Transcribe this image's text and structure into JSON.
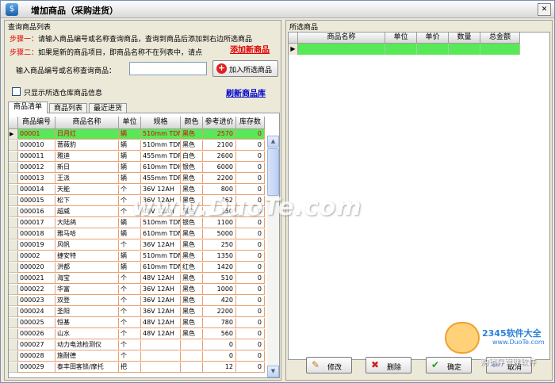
{
  "window": {
    "title": "增加商品（采购进货）",
    "close_glyph": "✕",
    "app_icon_glyph": "$"
  },
  "left_panel": {
    "title": "查询商品列表",
    "step1_label": "步骤一：",
    "step1_text": "请输入商品编号或名称查询商品，查询到商品后添加到右边所选商品",
    "step2_label": "步骤二：",
    "step2_text": "如果是新的商品项目，即商品名称不在列表中，请点",
    "add_new_link": "添加新商品",
    "search_label": "输入商品编号或名称查询商品：",
    "search_value": "",
    "add_button_label": "加入所选商品",
    "checkbox_label": "只显示所选仓库商品信息",
    "checkbox_checked": false,
    "refresh_link": "刷新商品库",
    "tabs": [
      {
        "label": "商品清单",
        "active": true
      },
      {
        "label": "商品列表",
        "active": false
      },
      {
        "label": "最近进货",
        "active": false
      }
    ]
  },
  "product_grid": {
    "columns": [
      "商品编号",
      "商品名称",
      "单位",
      "规格",
      "颜色",
      "参考进价",
      "库存数"
    ],
    "selected_index": 0,
    "rows": [
      [
        "00001",
        "日月红",
        "辆",
        "510mm TDN4",
        "黑色",
        "2570",
        "0"
      ],
      [
        "000010",
        "蔷薇豹",
        "辆",
        "510mm TDN4",
        "黑色",
        "2100",
        "0"
      ],
      [
        "000011",
        "雅迪",
        "辆",
        "455mm TDF1",
        "白色",
        "2600",
        "0"
      ],
      [
        "000012",
        "新日",
        "辆",
        "610mm TDH-",
        "银色",
        "6000",
        "0"
      ],
      [
        "000013",
        "王派",
        "辆",
        "455mm TDF1",
        "黑色",
        "2200",
        "0"
      ],
      [
        "000014",
        "天能",
        "个",
        "36V 12AH",
        "黑色",
        "800",
        "0"
      ],
      [
        "000015",
        "松下",
        "个",
        "36V 12AH",
        "黑色",
        "462",
        "0"
      ],
      [
        "000016",
        "超威",
        "个",
        "48V 12AH",
        "黑色",
        "350",
        "0"
      ],
      [
        "000017",
        "大陆鸽",
        "辆",
        "510mm TDNT",
        "银色",
        "1100",
        "0"
      ],
      [
        "000018",
        "雅马哈",
        "辆",
        "610mm TDMC",
        "黑色",
        "5000",
        "0"
      ],
      [
        "000019",
        "风帆",
        "个",
        "36V 12AH",
        "黑色",
        "250",
        "0"
      ],
      [
        "00002",
        "捷安特",
        "辆",
        "510mm TDN4",
        "黑色",
        "1350",
        "0"
      ],
      [
        "000020",
        "洪都",
        "辆",
        "610mm TDMC",
        "红色",
        "1420",
        "0"
      ],
      [
        "000021",
        "海宝",
        "个",
        "48V 12AH",
        "黑色",
        "510",
        "0"
      ],
      [
        "000022",
        "华富",
        "个",
        "36V 12AH",
        "黑色",
        "1000",
        "0"
      ],
      [
        "000023",
        "双登",
        "个",
        "36V 12AH",
        "黑色",
        "420",
        "0"
      ],
      [
        "000024",
        "圣阳",
        "个",
        "36V 12AH",
        "黑色",
        "2200",
        "0"
      ],
      [
        "000025",
        "恒基",
        "个",
        "48V 12AH",
        "黑色",
        "780",
        "0"
      ],
      [
        "000026",
        "山水",
        "个",
        "48V 12AH",
        "黑色",
        "560",
        "0"
      ],
      [
        "000027",
        "动力电池检测仪",
        "个",
        "",
        "",
        "0",
        "0"
      ],
      [
        "000028",
        "施耐德",
        "个",
        "",
        "",
        "0",
        "0"
      ],
      [
        "000029",
        "泰丰田客锁/摩托",
        "把",
        "",
        "",
        "12",
        "0"
      ]
    ]
  },
  "scrollbar": {
    "up_glyph": "▲",
    "down_glyph": "▼"
  },
  "right_panel": {
    "title": "所选商品",
    "columns": [
      "商品名称",
      "单位",
      "单价",
      "数量",
      "总金额"
    ],
    "buttons": [
      {
        "label": "修改",
        "icon": "✎"
      },
      {
        "label": "删除",
        "icon": "✖"
      },
      {
        "label": "确定",
        "icon": "✔"
      },
      {
        "label": "取消",
        "icon": "⇦"
      }
    ]
  },
  "watermarks": {
    "center": "www.DuoTe.com",
    "brand": "2345软件大全",
    "brand_url": "www.DuoTe.com",
    "brand_sub": "购销存管理软件"
  },
  "colors": {
    "selected_row": "#58e858",
    "red_text": "#e00000",
    "link_blue": "#0000cc",
    "grid_line": "#e8a070"
  }
}
